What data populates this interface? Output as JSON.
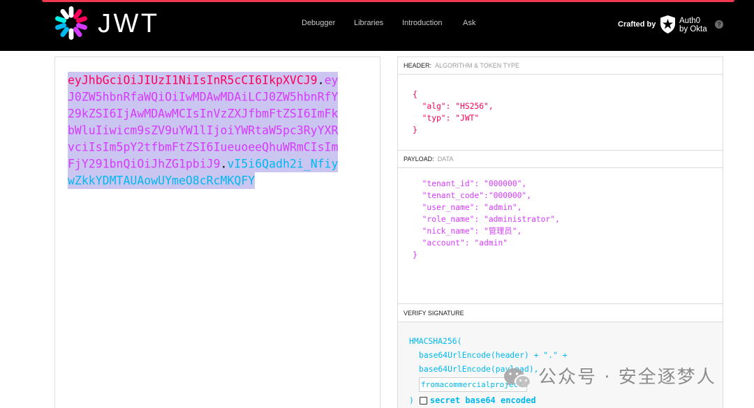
{
  "colors": {
    "header": "#fb015b",
    "payload": "#d63aff",
    "signature": "#00b9f1",
    "selection": "#cbc5f2",
    "accent": "#f2384f"
  },
  "logo": {
    "wordmark": "JWT",
    "icon": "jwt-logo-icon",
    "petal_colors": [
      "#ffffff",
      "#fb015b",
      "#fb015b",
      "#d63aff",
      "#d63aff",
      "#ffffff",
      "#00b9f1",
      "#00b9f1",
      "#00f2e6",
      "#ffffff"
    ]
  },
  "nav": {
    "items": [
      {
        "label": "Debugger"
      },
      {
        "label": "Libraries"
      },
      {
        "label": "Introduction"
      },
      {
        "label": "Ask"
      }
    ]
  },
  "credit": {
    "crafted_by": "Crafted by",
    "brand_icon": "auth0-shield-icon",
    "brand_line1": "Auth0",
    "brand_line2": "by Okta",
    "help_icon": "?"
  },
  "encoded": {
    "header": "eyJhbGciOiJIUzI1NiIsInR5cCI6IkpXVCJ9",
    "separator": ".",
    "payload": "eyJ0ZW5hbnRfaWQiOiIwMDAwMDAiLCJ0ZW5hbnRfY29kZSI6IjAwMDAwMCIsInVzZXJfbmFtZSI6ImFkbWluIiwicm9sZV9uYW1lIjoiYWRtaW5pc3RyYXRvciIsIm5pY2tfbmFtZSI6IueuoeeQhuWRmCIsImFjY291bnQiOiJhZG1pbiJ9",
    "signature": "vI5i6Qadh2i_NfiywZkkYDMTAUAowUYmeO8cRcMKQFY"
  },
  "decoded": {
    "header": {
      "label": "HEADER:",
      "sublabel": "ALGORITHM & TOKEN TYPE",
      "lines": [
        "{",
        "  \"alg\": \"HS256\",",
        "  \"typ\": \"JWT\"",
        "}"
      ]
    },
    "payload": {
      "label": "PAYLOAD:",
      "sublabel": "DATA",
      "lines": [
        "  \"tenant_id\": \"000000\",",
        "  \"tenant_code\":\"000000\",",
        "  \"user_name\": \"admin\",",
        "  \"role_name\": \"administrator\",",
        "  \"nick_name\": \"管理员\",",
        "  \"account\": \"admin\"",
        "}"
      ]
    },
    "verify": {
      "label": "VERIFY SIGNATURE",
      "fn_open": "HMACSHA256(",
      "arg1": "base64UrlEncode(header) + \".\" +",
      "arg2": "base64UrlEncode(payload),",
      "secret_value": "fromacommercialproject",
      "fn_close": ")",
      "secret_base64_encoded": false,
      "secret_base64_label": "secret base64 encoded"
    }
  },
  "watermark": {
    "icon": "wechat-icon",
    "text": "公众号 · 安全逐梦人"
  }
}
